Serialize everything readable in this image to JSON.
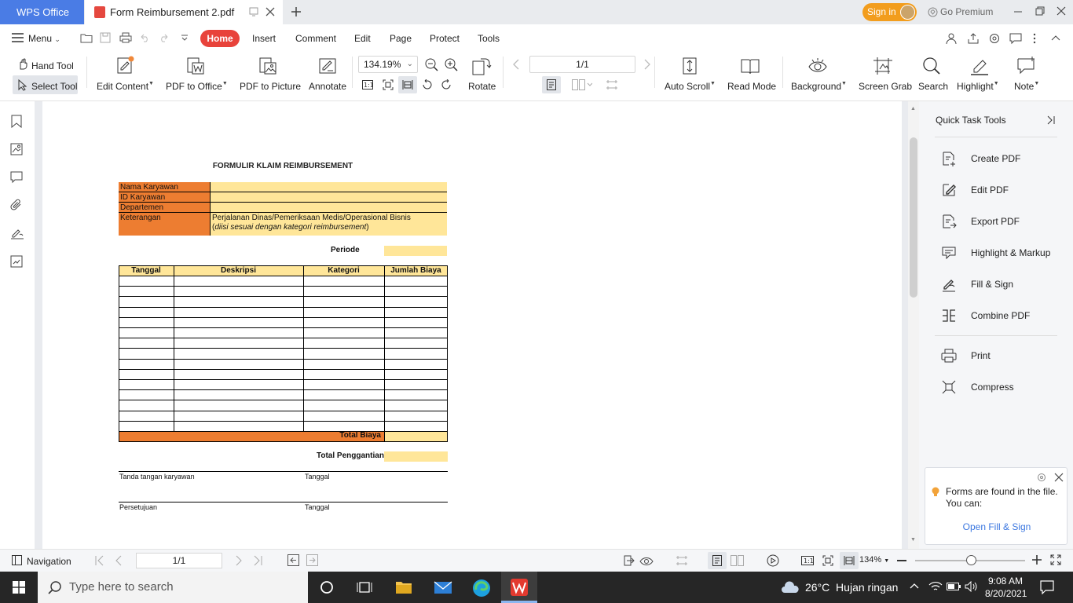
{
  "titlebar": {
    "app_name": "WPS Office",
    "doc_tab": "Form Reimbursement 2.pdf",
    "sign_in": "Sign in",
    "go_premium": "Go Premium"
  },
  "menubar": {
    "menu": "Menu",
    "tabs": [
      "Home",
      "Insert",
      "Comment",
      "Edit",
      "Page",
      "Protect",
      "Tools"
    ],
    "active_tab": "Home"
  },
  "toolbar": {
    "hand_tool": "Hand Tool",
    "select_tool": "Select Tool",
    "edit_content": "Edit Content",
    "pdf_to_office": "PDF to Office",
    "pdf_to_picture": "PDF to Picture",
    "annotate": "Annotate",
    "zoom_value": "134.19%",
    "rotate": "Rotate",
    "page_value": "1/1",
    "auto_scroll": "Auto Scroll",
    "read_mode": "Read Mode",
    "background": "Background",
    "screen_grab": "Screen Grab",
    "search": "Search",
    "highlight": "Highlight",
    "note": "Note"
  },
  "quick_tasks": {
    "title": "Quick Task Tools",
    "items": [
      "Create PDF",
      "Edit PDF",
      "Export PDF",
      "Highlight & Markup",
      "Fill & Sign",
      "Combine PDF",
      "Print",
      "Compress"
    ]
  },
  "forms_notice": {
    "message": "Forms are found in the file. You can:",
    "action": "Open Fill & Sign"
  },
  "statusbar": {
    "navigation": "Navigation",
    "page": "1/1",
    "zoom": "134%"
  },
  "taskbar": {
    "search_placeholder": "Type here to search",
    "weather": "26°C  Hujan ringan",
    "time": "9:08 AM",
    "date": "8/20/2021"
  },
  "document": {
    "title": "FORMULIR KLAIM REIMBURSEMENT",
    "fields": [
      "Nama Karyawan",
      "ID Karyawan",
      "Departemen",
      "Keterangan"
    ],
    "keterangan_line1": "Perjalanan Dinas/Pemeriksaan Medis/Operasional Bisnis",
    "keterangan_line2_prefix": "(",
    "keterangan_line2_italic": "diisi sesuai dengan kategori reimbursement",
    "keterangan_line2_suffix": ")",
    "periode": "Periode",
    "columns": [
      "Tanggal",
      "Deskripsi",
      "Kategori",
      "Jumlah Biaya"
    ],
    "total_biaya": "Total Biaya",
    "total_penggantian": "Total Penggantian",
    "sign_employee": "Tanda tangan karyawan",
    "sign_date1": "Tanggal",
    "approval": "Persetujuan",
    "sign_date2": "Tanggal"
  },
  "colors": {
    "brand_blue": "#4a7ce5",
    "home_red": "#e8433b",
    "sign_in_orange": "#f29d1d",
    "form_orange": "#ed7d31",
    "form_cream": "#ffe699"
  }
}
